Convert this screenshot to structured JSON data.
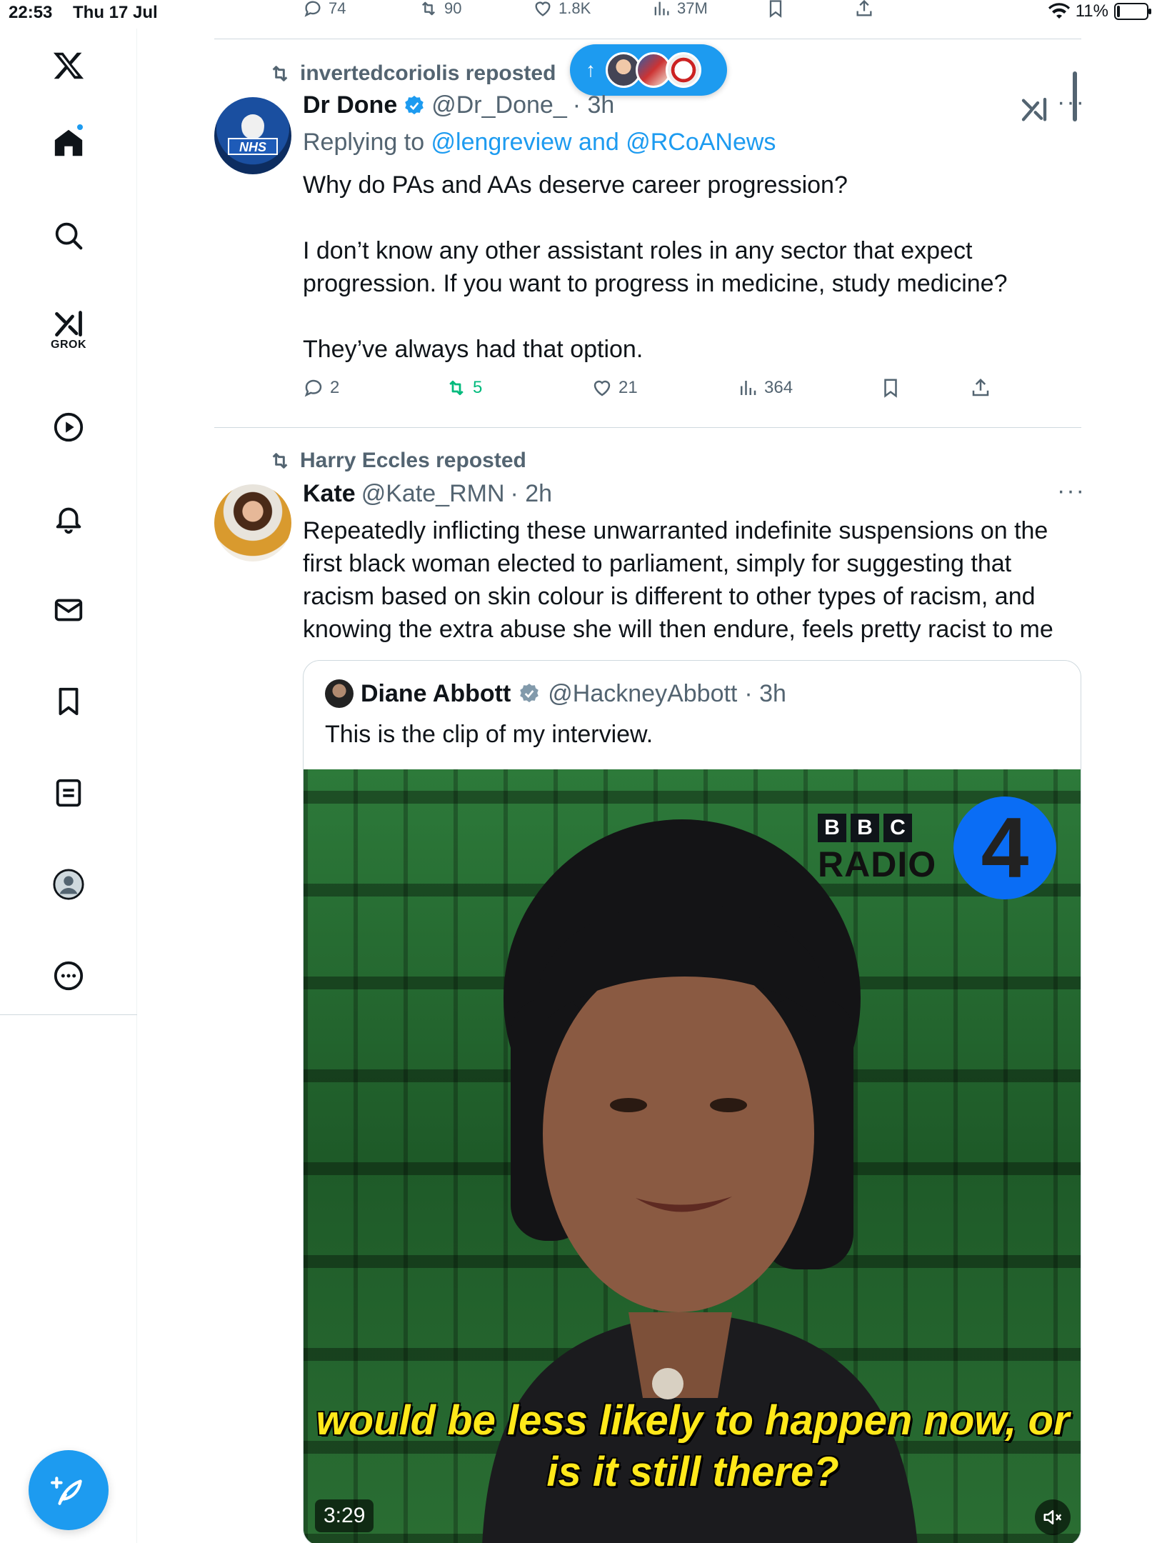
{
  "status_bar": {
    "time": "22:53",
    "date": "Thu 17 Jul",
    "battery": "11%",
    "battery_level": 0.11
  },
  "sidebar": {
    "grok_label": "GROK"
  },
  "previous_tweet": {
    "replies": "74",
    "reposts": "90",
    "likes": "1.8K",
    "views": "37M"
  },
  "new_posts_pill": {
    "arrow": "↑"
  },
  "tweets": [
    {
      "repost_by": "invertedcoriolis reposted",
      "name": "Dr Done",
      "handle": "@Dr_Done_",
      "time": "· 3h",
      "replying_prefix": "Replying to ",
      "replying_to": "@lengreview and @RCoANews",
      "text": "Why do PAs and AAs deserve career progression?\n\nI don’t know any other assistant roles in any sector that expect progression. If you want to progress in medicine, study medicine?\n\nThey’ve always had that option.",
      "replies": "2",
      "reposts": "5",
      "likes": "21",
      "views": "364"
    },
    {
      "repost_by": "Harry Eccles reposted",
      "name": "Kate",
      "handle": "@Kate_RMN",
      "time": "· 2h",
      "text": "Repeatedly inflicting these unwarranted indefinite suspensions on the first black woman elected to parliament, simply for suggesting that racism based on skin colour is different to other types of racism, and knowing the extra abuse she will then endure, feels pretty racist to me",
      "quote": {
        "name": "Diane Abbott",
        "handle": "@HackneyAbbott",
        "time": "· 3h",
        "text": "This is the clip of my interview.",
        "video": {
          "logo_letters": [
            "B",
            "B",
            "C"
          ],
          "logo_word": "RADIO",
          "channel_number": "4",
          "subtitle": "would be less likely to happen now, or is it still there?",
          "duration": "3:29"
        }
      }
    }
  ],
  "colors": {
    "accent": "#1d9bf0",
    "repost_green": "#00ba7c",
    "muted": "#536471"
  }
}
